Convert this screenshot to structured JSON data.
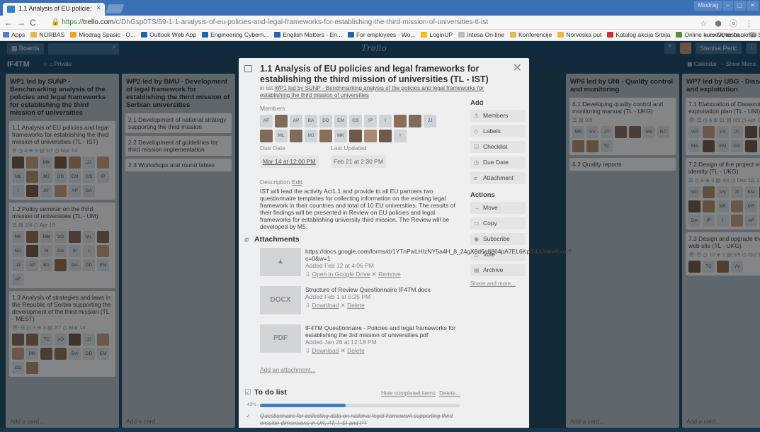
{
  "browser": {
    "tab_title": "1.1 Analysis of EU policie:",
    "url_prefix": "https://",
    "url_domain": "trello.com",
    "url_path": "/c/DhGsp0TS/59-1-1-analysis-of-eu-policies-and-legal-frameworks-for-establishing-the-third-mission-of-universities-tl-ist",
    "window_controls": [
      "Miodrag",
      "–",
      "▢",
      "✕"
    ],
    "bookmarks": [
      {
        "label": "Apps",
        "color": "#4a7fd0"
      },
      {
        "label": "NORBAS",
        "color": "#e8b64a"
      },
      {
        "label": "Miodrag Spasic - O...",
        "color": "#f0a020"
      },
      {
        "label": "Outlook Web App",
        "color": "#1f63b5"
      },
      {
        "label": "Engineering Cybern...",
        "color": "#1f63b5"
      },
      {
        "label": "English Matters - En...",
        "color": "#1f63b5"
      },
      {
        "label": "For employees - Wo...",
        "color": "#1f63b5"
      },
      {
        "label": "LoginUP",
        "color": "#f2c200"
      },
      {
        "label": "Intesa On-line",
        "color": "#bbb"
      },
      {
        "label": "Konferencije",
        "color": "#e8b64a"
      },
      {
        "label": "Norveska put",
        "color": "#e8b64a"
      },
      {
        "label": "Katalog akcija Srbija",
        "color": "#d0302a"
      },
      {
        "label": "Online kursevi, testo...",
        "color": "#5a8c3a"
      },
      {
        "label": "Save to Mendeley",
        "color": "#bbb"
      }
    ],
    "other_bookmarks": "Other bookmar"
  },
  "trello": {
    "boards_label": "Boards",
    "logo": "Trello",
    "user_name": "Stanisa Perić",
    "board_name": "IF4TM",
    "board_meta": "☆   ⌂ Private",
    "board_right": "▦ Calendar  ···  Show Menu"
  },
  "lists": [
    {
      "title": "WP1 led by SUNP - Benchmarking analysis of the policies and legal frameworks for establishing the third mission of universities",
      "cards": [
        {
          "text": "1.1 Analysis of EU policies and legal frameworks for establishing the third mission of universities (TL - IST)",
          "badges": "☰  ◷ 4  ⊕ 3  ▤ 3/7  ◷ Mar 14",
          "faces": [
            "f",
            "f",
            "init:MK",
            "f",
            "f",
            "init:JJ",
            "f",
            "init:ML",
            "f",
            "init:MJ",
            "init:DD",
            "init:EM",
            "init:GS",
            "init:IP",
            "init:I",
            "f",
            "init:AF",
            "f",
            "init:AP",
            "init:BA"
          ]
        },
        {
          "text": "1.2 Policy seminar on the third mission of universities (TL - UM)",
          "badges": "☰  ▤ 2/4  ◷ Apr 19",
          "faces": [
            "init:MK",
            "f",
            "init:RM",
            "init:VO",
            "f",
            "init:ML",
            "f",
            "init:MJ",
            "f",
            "init:M",
            "init:GS",
            "init:IP",
            "init:I",
            "f",
            "init:JJ",
            "init:AP",
            "init:BA",
            "f",
            "init:DA",
            "init:DD",
            "init:EM",
            "init:AF"
          ]
        },
        {
          "text": "1.3 Analysis of strategies and laws in the Republic of Serbia supporting the development of the third mission (TL - MEST)",
          "badges": "👁  ☰  ◷ 3  ⊕ 3  ▤ 2/7  ◷ Mar 14",
          "faces": [
            "f",
            "f",
            "init:TC",
            "init:VO",
            "f",
            "init:JJ",
            "f",
            "f",
            "init:MK",
            "f",
            "f",
            "init:DA",
            "init:DD",
            "init:EM",
            "init:GS",
            "f"
          ]
        }
      ],
      "add": "Add a card..."
    },
    {
      "title": "WP2 led by BMU - Development of legal framework for establishing the third mission of Serbian universities",
      "cards": [
        {
          "text": "2.1 Development of national strategy supporting the third mission",
          "badges": "",
          "faces": []
        },
        {
          "text": "2.2 Development of guidelines for third mission implementation",
          "badges": "",
          "faces": []
        },
        {
          "text": "2.3 Workshops and round tables",
          "badges": "",
          "faces": []
        }
      ],
      "add": "Add a card..."
    },
    {
      "title": "WP6 led by UNI - Quality control and monitoring",
      "cards": [
        {
          "text": "6.1 Developing quality control and monitoring manual (TL - UKG)",
          "badges": "☰  ▤ 0/8",
          "faces": [
            "init:MS",
            "init:VV",
            "init:JT",
            "f",
            "f",
            "init:MS",
            "init:RC",
            "f",
            "f",
            "init:TC"
          ]
        },
        {
          "text": "6.2 Quality reports",
          "badges": "",
          "faces": []
        }
      ],
      "add": "Add a card..."
    },
    {
      "title": "WP7 led by UBG - Dissemination and exploitation",
      "cards": [
        {
          "text": "7.1 Elaboration of Dissemination and exploitation plan (TL - UNI)",
          "badges": "👁  ☰  ◷ 6  ⊕ 11  ▤ 0/5  ◷ Apr 14",
          "faces": [
            "init:VO",
            "f",
            "init:VV",
            "init:JT",
            "f",
            "f",
            "init:MS",
            "init:MA",
            "f",
            "init:EM",
            "init:GS",
            "f"
          ]
        },
        {
          "text": "7.2 Design of the project visual identity (TL - UKG)",
          "badges": "☰  ◷ 6  ⊕ 3  ▤ 4/6  ◷ Dec 18, 2015",
          "faces": [
            "init:VO",
            "f",
            "init:VV",
            "init:JT",
            "init:KM",
            "f",
            "f",
            "f",
            "f",
            "init:MK",
            "f",
            "init:MS",
            "init:MA",
            "f",
            "init:DA",
            "init:IP",
            "init:I",
            "f",
            "init:AP",
            "init:BA",
            "f"
          ]
        },
        {
          "text": "7.3 Design and upgrade the project web site (TL - UKG)",
          "badges": "👁  ☰  ◷ 12  ⊕ 1  ▤ 5/5  ◷ Oct 14, 2016",
          "faces": [
            "f",
            "init:TC",
            "f",
            "init:VV"
          ]
        }
      ],
      "add": "Add a card..."
    }
  ],
  "card": {
    "title": "1.1 Analysis of EU policies and legal frameworks for establishing the third mission of universities (TL - IST)",
    "in_list_prefix": "in list ",
    "in_list_name": "WP1 led by SUNP - Benchmarking analysis of the policies and legal frameworks for establishing the third mission of universities",
    "members_label": "Members",
    "members": [
      "init:AF",
      "f",
      "init:AP",
      "init:BA",
      "init:DD",
      "init:EM",
      "init:GS",
      "init:IP",
      "init:I",
      "f",
      "f",
      "init:JJ",
      "f",
      "init:ML",
      "f",
      "init:MJ",
      "f",
      "init:MK",
      "f",
      "f",
      "f",
      "+"
    ],
    "due_label": "Due Date",
    "due_value": "Mar 14 at 12:00 PM",
    "updated_label": "Last Updated",
    "updated_value": "Feb 21 at 2:30 PM",
    "desc_label": "Description",
    "desc_edit": "Edit",
    "description": "IST will lead the activity Act1.1 and provide to all EU partners two questionnaire templates for collecting information on the existing legal framework in their countries and total of 10 EU universities. The results of their findings will be presented in Review on EU policies and legal frameworks for establishing university third mission. The Review will be developed by M5.",
    "attachments_label": "Attachments",
    "attachments": [
      {
        "thumb": "▲",
        "name": "https://docs.google.com/forms/d/1YTnPwLHIzNY5a4H_8_24gX8d6e8864pA7EL6KplGLk/viewform?c=0&w=1",
        "added": "Added Feb 12 at 4:06 PM",
        "link1": "Open in Google Drive",
        "link2": "Remove"
      },
      {
        "thumb": "DOCX",
        "name": "Structure of Review Questionnaire IF4TM.docx",
        "added": "Added Feb 1 at 5:25 PM",
        "link1": "Download",
        "link2": "Delete"
      },
      {
        "thumb": "PDF",
        "name": "IF4TM Questionnaire - Policies and legal frameworks for establishing the 3rd mission of universities.pdf",
        "added": "Added Jan 26 at 12:18 PM",
        "link1": "Download",
        "link2": "Delete"
      }
    ],
    "add_attachment": "Add an attachment...",
    "todo_label": "To do list",
    "todo_hide": "Hide completed items",
    "todo_delete": "Delete...",
    "todo_progress_pct": "43%",
    "todo_progress": 0.43,
    "todo_first_item": "Questionnaire for collecting data on national legal framework supporting third mission dimensions in UK, AT, I, SI and PT",
    "add_label": "Add",
    "add_buttons": [
      {
        "icon": "♙",
        "label": "Members"
      },
      {
        "icon": "◇",
        "label": "Labels"
      },
      {
        "icon": "☑",
        "label": "Checklist"
      },
      {
        "icon": "◷",
        "label": "Due Date"
      },
      {
        "icon": "⌀",
        "label": "Attachment"
      }
    ],
    "actions_label": "Actions",
    "action_buttons": [
      {
        "icon": "→",
        "label": "Move"
      },
      {
        "icon": "▭",
        "label": "Copy"
      },
      {
        "icon": "◉",
        "label": "Subscribe"
      },
      {
        "icon": "△",
        "label": "Vote"
      },
      {
        "icon": "▤",
        "label": "Archive"
      }
    ],
    "share": "Share and more..."
  }
}
